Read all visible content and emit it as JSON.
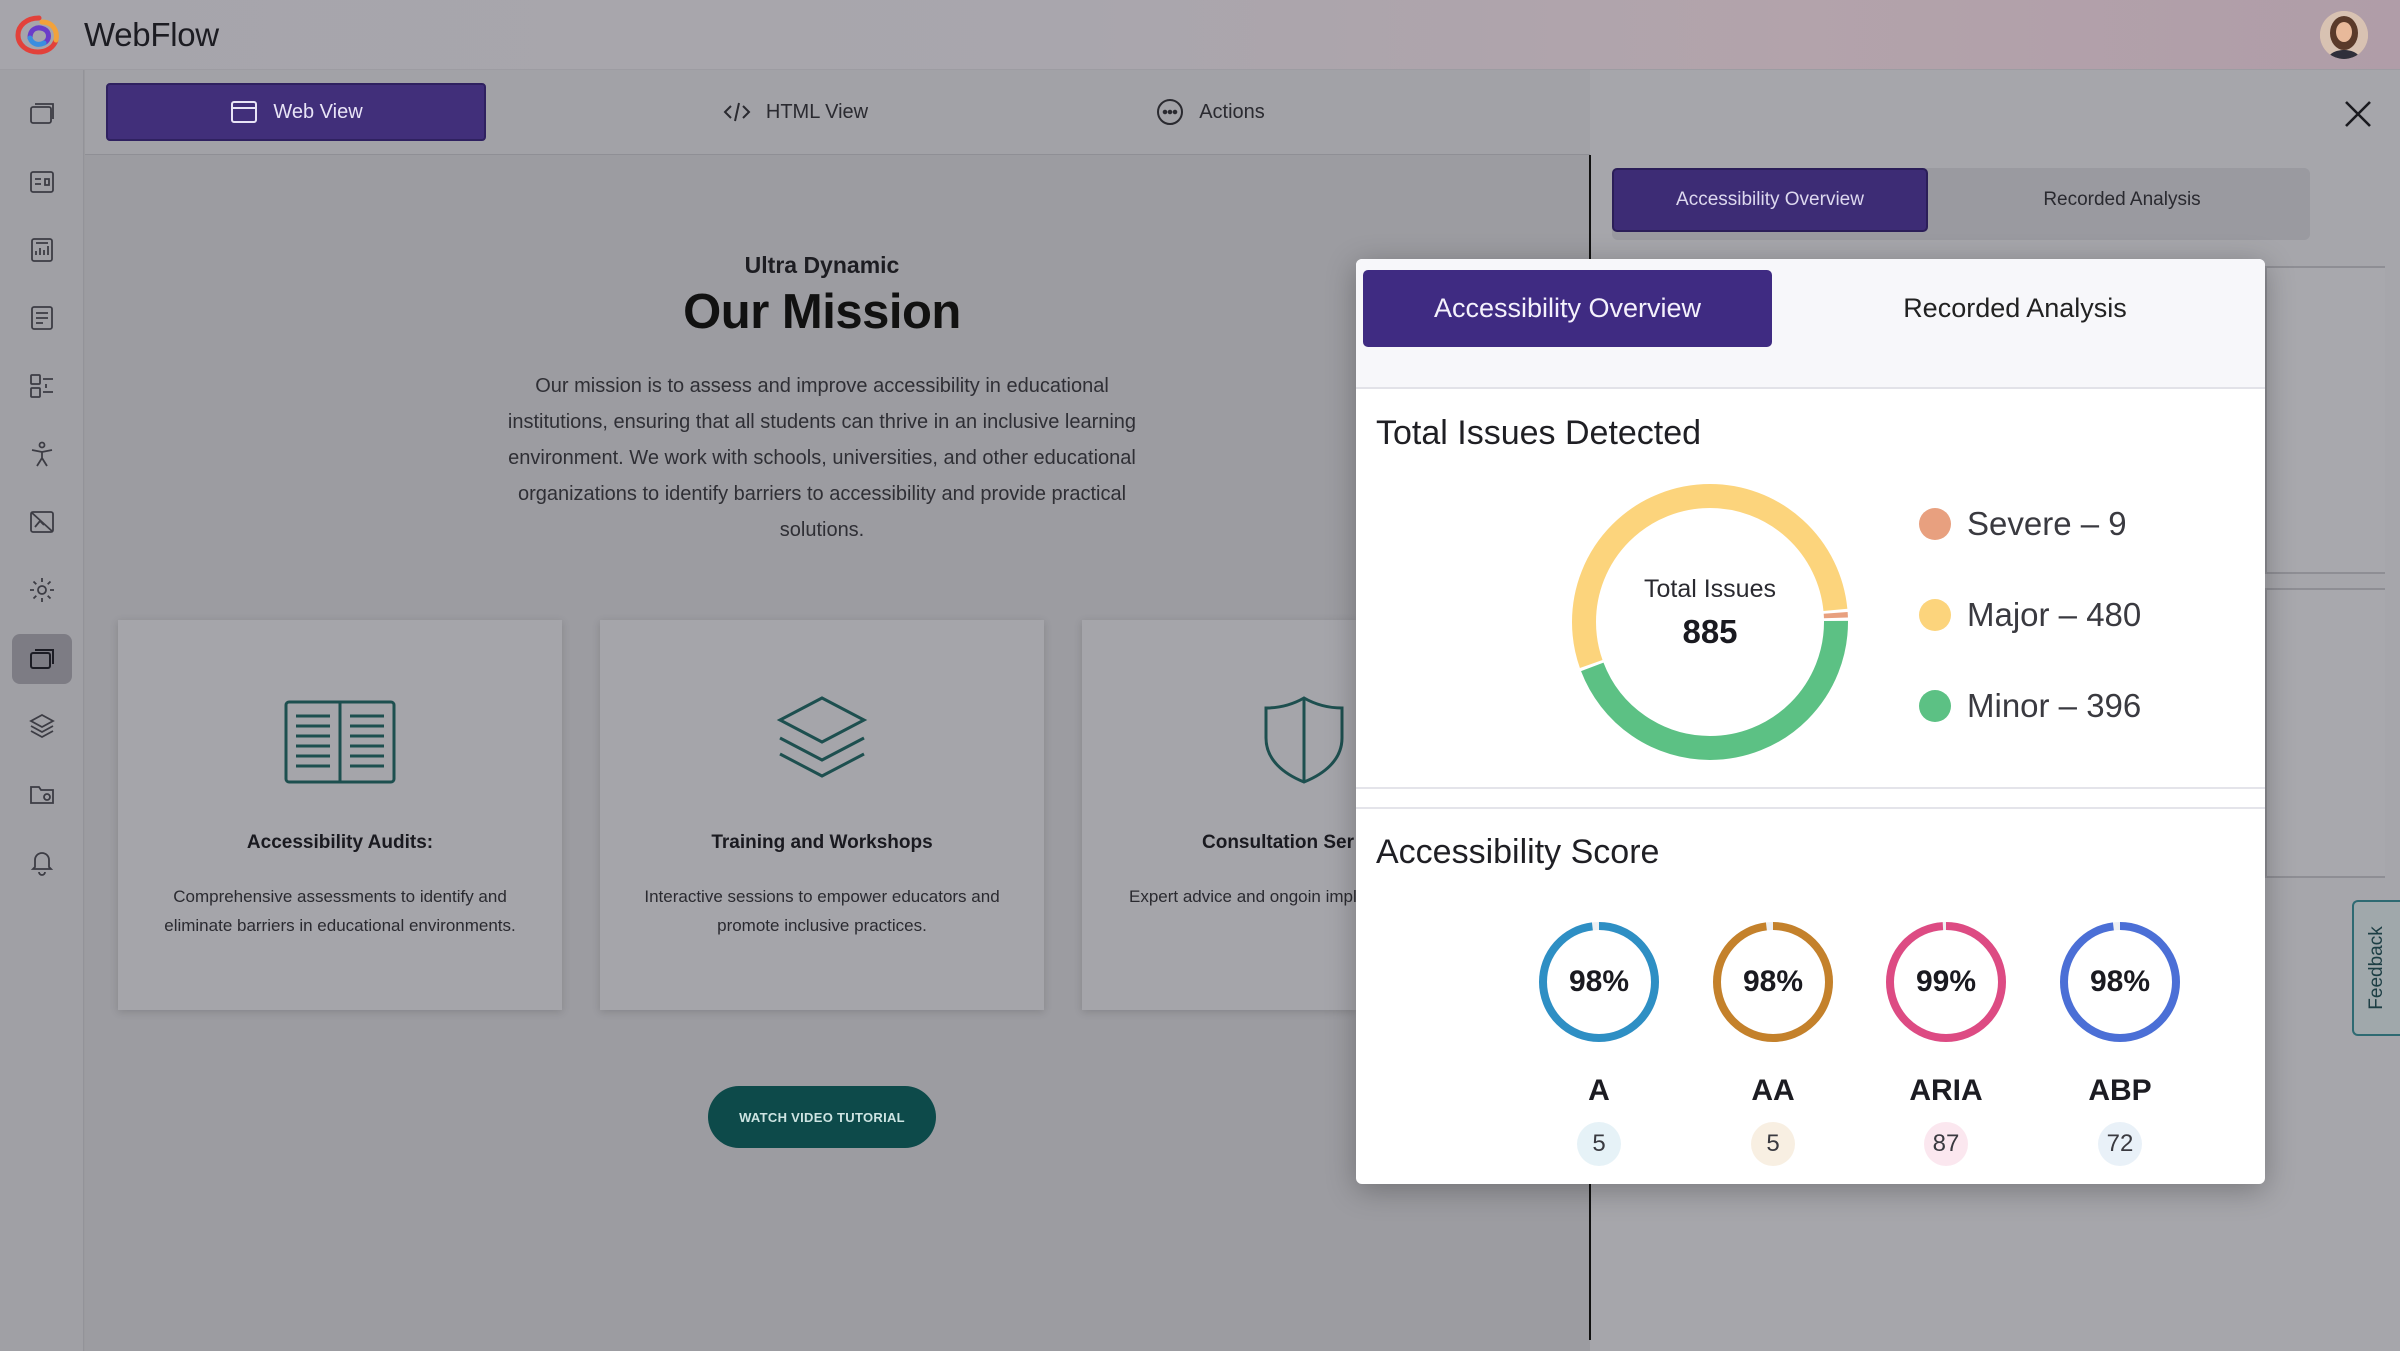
{
  "app": {
    "title": "WebFlow"
  },
  "view_tabs": [
    {
      "label": "Web View",
      "icon": "window-icon",
      "active": true
    },
    {
      "label": "HTML View",
      "icon": "code-icon",
      "active": false
    },
    {
      "label": "Actions",
      "icon": "more-icon",
      "active": false
    }
  ],
  "hero": {
    "subtitle": "Ultra Dynamic",
    "title": "Our Mission",
    "text": "Our mission is to assess and improve accessibility in educational institutions, ensuring that all students can thrive in an inclusive learning environment. We work with schools, universities, and other educational organizations to identify barriers to accessibility and provide practical solutions."
  },
  "cards": [
    {
      "title": "Accessibility Audits:",
      "text": "Comprehensive assessments to identify and eliminate barriers in educational environments.",
      "icon": "book-icon"
    },
    {
      "title": "Training and Workshops",
      "text": "Interactive sessions to empower educators and promote inclusive practices.",
      "icon": "layers-icon"
    },
    {
      "title": "Consultation Ser",
      "text": "Expert advice and ongoin implement effective accessil",
      "icon": "shield-icon"
    }
  ],
  "video_button": {
    "label": "WATCH VIDEO TUTORIAL"
  },
  "right_panel": {
    "tabs": [
      {
        "label": "Accessibility Overview",
        "active": true
      },
      {
        "label": "Recorded Analysis",
        "active": false
      }
    ],
    "feedback_label": "Feedback"
  },
  "modal": {
    "tabs": [
      {
        "label": "Accessibility Overview",
        "active": true
      },
      {
        "label": "Recorded Analysis",
        "active": false
      }
    ],
    "issues": {
      "title": "Total Issues Detected",
      "center_label": "Total Issues",
      "total": "885",
      "legend": [
        {
          "label": "Severe – 9",
          "value": 9,
          "color": "#e8a07f"
        },
        {
          "label": "Major – 480",
          "value": 480,
          "color": "#fcd47c"
        },
        {
          "label": "Minor – 396",
          "value": 396,
          "color": "#5cc184"
        }
      ]
    },
    "score": {
      "title": "Accessibility Score",
      "items": [
        {
          "name": "A",
          "percent": "98%",
          "value": 98,
          "count": "5",
          "ring_color": "#2e8fc4",
          "badge_color": "#e6f2f7"
        },
        {
          "name": "AA",
          "percent": "98%",
          "value": 98,
          "count": "5",
          "ring_color": "#c4812b",
          "badge_color": "#f8efe2"
        },
        {
          "name": "ARIA",
          "percent": "99%",
          "value": 99,
          "count": "87",
          "ring_color": "#dd4b83",
          "badge_color": "#fbe7ef"
        },
        {
          "name": "ABP",
          "percent": "98%",
          "value": 98,
          "count": "72",
          "ring_color": "#4b6fd6",
          "badge_color": "#e9f1f8"
        }
      ]
    }
  },
  "colors": {
    "accent": "#3f2b82",
    "brand_teal": "#0d4a4a"
  }
}
